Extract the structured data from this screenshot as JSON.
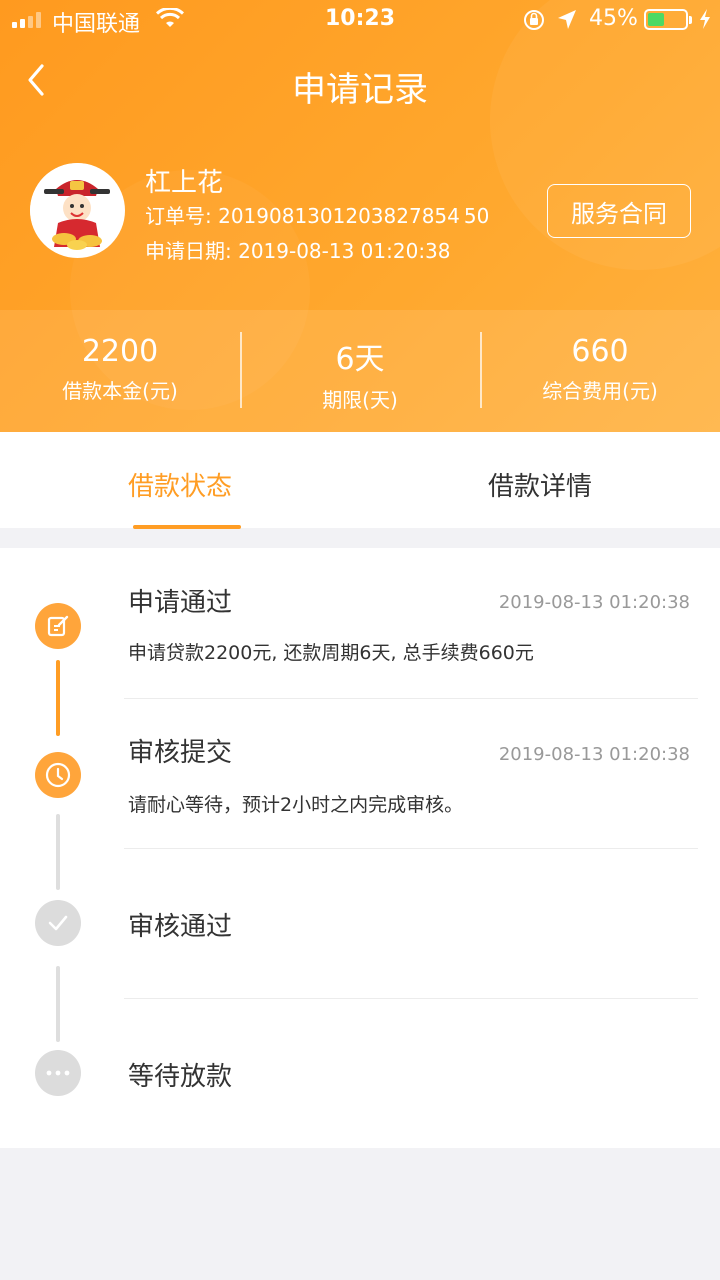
{
  "status_bar": {
    "carrier": "中国联通",
    "time": "10:23",
    "battery": "45%",
    "battery_level": 0.45
  },
  "nav": {
    "title": "申请记录"
  },
  "profile": {
    "name": "杠上花",
    "order_label": "订单号: 2019081301203827854 50",
    "date_label": "申请日期: 2019-08-13 01:20:38",
    "contract_button": "服务合同"
  },
  "stats": [
    {
      "value": "2200",
      "label": "借款本金(元)"
    },
    {
      "value": "6天",
      "label": "期限(天)"
    },
    {
      "value": "660",
      "label": "综合费用(元)"
    }
  ],
  "tabs": [
    {
      "label": "借款状态",
      "active": true
    },
    {
      "label": "借款详情",
      "active": false
    }
  ],
  "steps": [
    {
      "title": "申请通过",
      "time": "2019-08-13 01:20:38",
      "desc": "申请贷款2200元, 还款周期6天, 总手续费660元",
      "icon": "edit-icon",
      "done": true
    },
    {
      "title": "审核提交",
      "time": "2019-08-13 01:20:38",
      "desc": "请耐心等待，预计2小时之内完成审核。",
      "icon": "clock-icon",
      "done": true
    },
    {
      "title": "审核通过",
      "time": "",
      "desc": "",
      "icon": "check-icon",
      "done": false
    },
    {
      "title": "等待放款",
      "time": "",
      "desc": "",
      "icon": "more-icon",
      "done": false
    }
  ],
  "colors": {
    "accent": "#ff9d24",
    "header": "#ffa32d",
    "inactive": "#dcdcdc"
  }
}
